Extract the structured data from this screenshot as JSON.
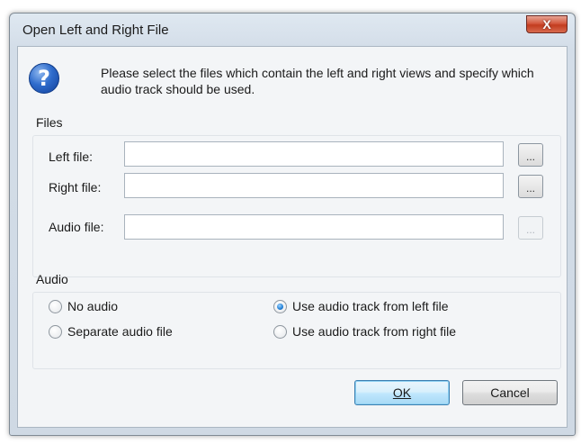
{
  "window": {
    "title": "Open Left and Right File",
    "close_glyph": "X"
  },
  "prompt": {
    "icon": "question-icon",
    "icon_glyph": "?",
    "text": "Please select the files which contain the left and right views and specify which audio track should be used."
  },
  "files": {
    "group_label": "Files",
    "left": {
      "label": "Left file:",
      "value": "",
      "browse": "..."
    },
    "right": {
      "label": "Right file:",
      "value": "",
      "browse": "..."
    },
    "audio": {
      "label": "Audio file:",
      "value": "",
      "browse": "...",
      "enabled": false
    }
  },
  "audio": {
    "group_label": "Audio",
    "options": [
      {
        "label": "No audio",
        "checked": false
      },
      {
        "label": "Separate audio file",
        "checked": false
      },
      {
        "label": "Use audio track from left file",
        "checked": true
      },
      {
        "label": "Use audio track from right file",
        "checked": false
      }
    ]
  },
  "buttons": {
    "ok": "OK",
    "cancel": "Cancel"
  },
  "colors": {
    "close_button": "#c9452a",
    "help_icon": "#2f6ccc",
    "default_button": "#bee6fd"
  }
}
